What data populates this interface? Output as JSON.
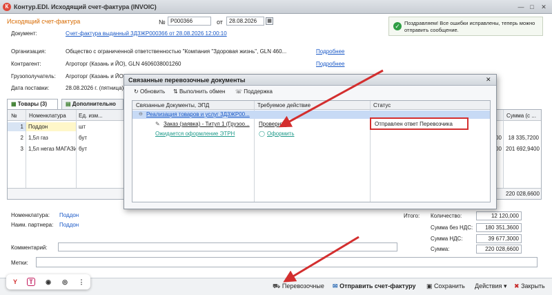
{
  "window": {
    "title": "Контур.EDI. Исходящий счет-фактура (INVOIC)",
    "minimize": "—",
    "maximize": "□",
    "close": "✕"
  },
  "header": {
    "doc_type": "Исходящий счет-фактура",
    "num_label": "№",
    "num_value": "P000366",
    "date_label": "от",
    "date_value": "28.08.2026",
    "document_label": "Документ:",
    "document_link": "Счет-фактура выданный 3Д3ЖР000366 от 28.08.2026 12:00:10"
  },
  "notice": {
    "text": "Поздравляем! Все ошибки исправлены, теперь можно отправить сообщение."
  },
  "fields": {
    "org_label": "Организация:",
    "org_value": "Общество с ограниченной ответственностью \"Компания \"Здоровая жизнь\", GLN 460...",
    "org_more": "Подробнее",
    "contr_label": "Контрагент:",
    "contr_value": "Агроторг (Казань и ЙО), GLN 4606038001260",
    "contr_more": "Подробнее",
    "consignee_label": "Грузополучатель:",
    "consignee_value": "Агроторг (Казань и ЙО), GLN 460603800126",
    "delivery_label": "Дата поставки:",
    "delivery_value": "28.08.2026 г. (пятница)"
  },
  "tabs": {
    "goods": "Товары (3)",
    "additional": "Дополнительно"
  },
  "grid": {
    "col_num": "№",
    "col_name": "Номенклатура",
    "col_unit": "Ед. изм...",
    "col_sum": "Сумма (с ...",
    "rows": [
      {
        "n": "1",
        "name": "Поддон",
        "unit": "шт",
        "sum": ""
      },
      {
        "n": "2",
        "name": "1,5л газ",
        "unit": "бут",
        "sum": "18 335,7200",
        "extra": "00"
      },
      {
        "n": "3",
        "name": "1,5л негаз МАГАЗИНЫ",
        "unit": "бут",
        "sum": "201 692,9400",
        "extra": "00"
      }
    ],
    "total_sum": "220 028,6600"
  },
  "dialog": {
    "title": "Связанные перевозочные документы",
    "close": "✕",
    "refresh": "Обновить",
    "exchange": "Выполнить обмен",
    "support": "Поддержка",
    "col_docs": "Связанные Документы, ЭПД",
    "col_action": "Требуемое действие",
    "col_status": "Статус",
    "rows": [
      {
        "doc": "Реализация товаров и услуг 3Д3ЖР00...",
        "action": "",
        "status": ""
      },
      {
        "doc": "Заказ (заявка) - Титул 1 (Грузоо...",
        "action": "Проверить",
        "status": "Отправлен ответ Перевозчика"
      },
      {
        "doc": "Ожидается оформление ЭТРН",
        "action": "Оформить",
        "status": ""
      }
    ]
  },
  "summary": {
    "nomenclature_label": "Номенклатура:",
    "nomenclature_value": "Поддон",
    "partner_label": "Наим. партнера:",
    "partner_value": "Поддон",
    "total_label": "Итого:",
    "qty_label": "Количество:",
    "qty_value": "12 120,000",
    "sum_novat_label": "Сумма без НДС:",
    "sum_novat_value": "180 351,3600",
    "vat_label": "Сумма НДС:",
    "vat_value": "39 677,3000",
    "sum_label": "Сумма:",
    "sum_value": "220 028,6600",
    "comment_label": "Комментарий:",
    "marks_label": "Метки:"
  },
  "bottom": {
    "transport": "Перевозочные",
    "send": "Отправить счет-фактуру",
    "save": "Сохранить",
    "actions": "Действия",
    "close": "Закрыть"
  },
  "colors": {
    "accent_orange": "#d76a00",
    "link_blue": "#1a59c7",
    "highlight_red": "#d32f2f",
    "success_green": "#2f9e44"
  }
}
